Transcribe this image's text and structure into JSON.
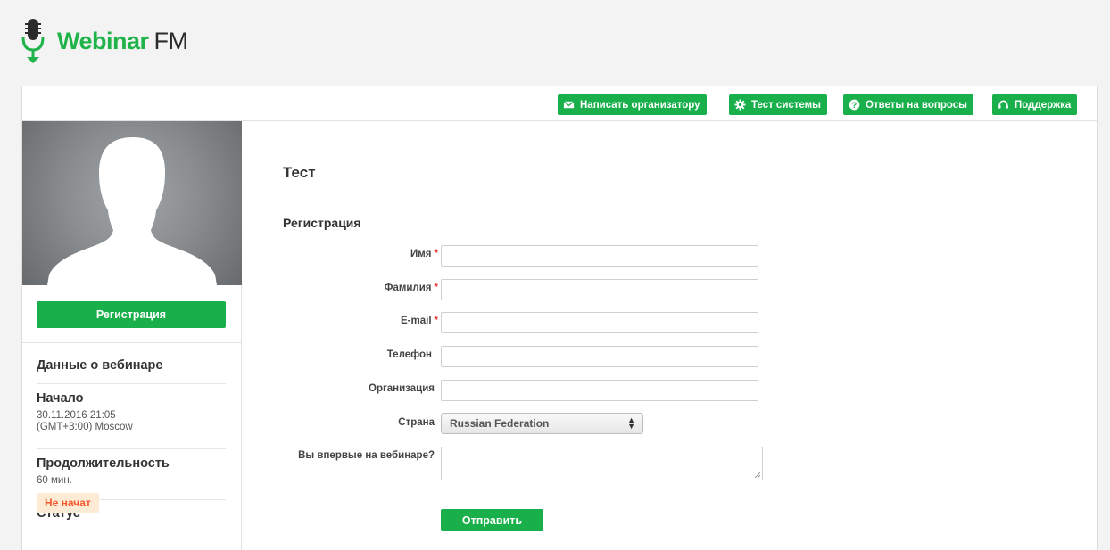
{
  "brand": {
    "name": "Webinar",
    "suffix": "FM",
    "accent_color": "#19b04b",
    "logo_icon": "microphone-icon"
  },
  "toolbar": {
    "buttons": [
      {
        "label": "Написать организатору",
        "icon": "envelope-icon"
      },
      {
        "label": "Тест системы",
        "icon": "gear-icon"
      },
      {
        "label": "Ответы на вопросы",
        "icon": "question-icon"
      },
      {
        "label": "Поддержка",
        "icon": "headset-icon"
      }
    ]
  },
  "sidebar": {
    "avatar_icon": "user-silhouette-icon",
    "register_label": "Регистрация",
    "info_title": "Данные о вебинаре",
    "start": {
      "label": "Начало",
      "date": "30.11.2016 21:05",
      "timezone": "(GMT+3:00) Moscow"
    },
    "duration": {
      "label": "Продолжительность",
      "value": "60 мин."
    },
    "status": {
      "label": "Статус",
      "value": "Не начат",
      "color": "#f5562b"
    }
  },
  "main": {
    "title": "Тест",
    "section": "Регистрация",
    "required_mark": "*",
    "fields": [
      {
        "label": "Имя",
        "required": true,
        "value": ""
      },
      {
        "label": "Фамилия",
        "required": true,
        "value": ""
      },
      {
        "label": "E-mail",
        "required": true,
        "value": ""
      },
      {
        "label": "Телефон",
        "required": false,
        "value": ""
      },
      {
        "label": "Организация",
        "required": false,
        "value": ""
      }
    ],
    "country": {
      "label": "Страна",
      "value": "Russian Federation"
    },
    "first_time": {
      "label": "Вы впервые на вебинаре?",
      "value": ""
    },
    "submit_label": "Отправить"
  }
}
